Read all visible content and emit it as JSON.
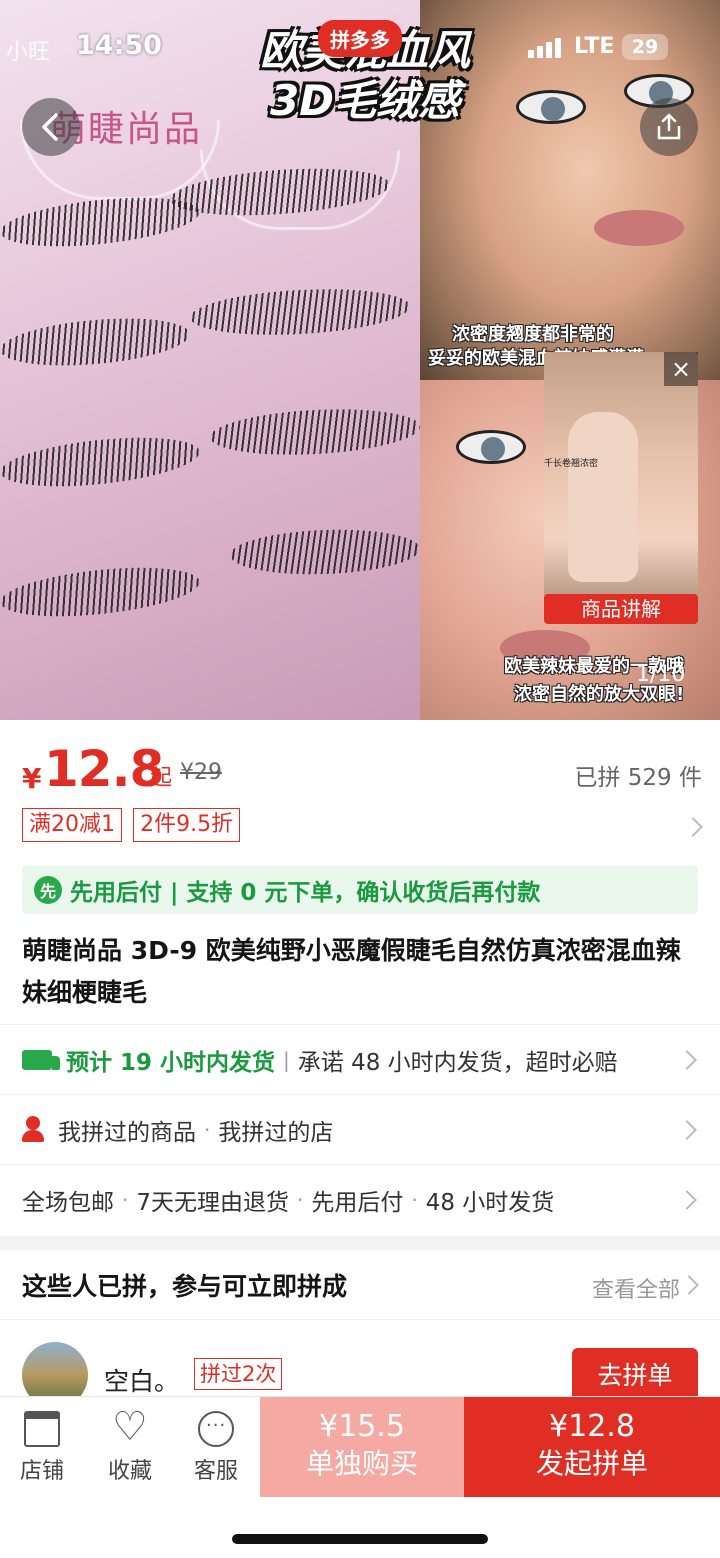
{
  "status_bar": {
    "app": "小旺",
    "time": "14:50",
    "network": "LTE",
    "battery": "29"
  },
  "hero": {
    "brand": "萌睫尚品",
    "caption_line1": "欧美混血风",
    "caption_line2": "3D毛绒感",
    "badge": "拼多多",
    "overlay1": "浓密度翘度都非常的",
    "overlay2": "妥妥的欧美混血辣妹感满满",
    "overlay3": "欧美辣妹最爱的一款哦",
    "overlay4": "浓密自然的放大双眼!",
    "video_small_text": "千长卷翘浓密",
    "video_label": "商品讲解",
    "counter": "1/10"
  },
  "price": {
    "currency": "¥",
    "value": "12.8",
    "suffix": "起",
    "original": "¥29",
    "sold": "已拼 529 件"
  },
  "promos": [
    "满20减1",
    "2件9.5折"
  ],
  "pay_later": {
    "icon": "先",
    "text": "先用后付 | 支持 0 元下单，确认收货后再付款"
  },
  "product_title": "萌睫尚品 3D-9 欧美纯野小恶魔假睫毛自然仿真浓密混血辣妹细梗睫毛",
  "shipping": {
    "eta": "预计 19 小时内发货",
    "promise": "承诺 48 小时内发货，超时必赔"
  },
  "history": {
    "item1": "我拼过的商品",
    "item2": "我拼过的店"
  },
  "services": [
    "全场包邮",
    "7天无理由退货",
    "先用后付",
    "48 小时发货"
  ],
  "join_section": {
    "title": "这些人已拼，参与可立即拼成",
    "more": "查看全部"
  },
  "joiner": {
    "name": "空白。",
    "tag": "拼过2次",
    "button": "去拼单"
  },
  "bottom_bar": {
    "store": "店铺",
    "favorite": "收藏",
    "service": "客服",
    "alone_price": "¥15.5",
    "alone_label": "单独购买",
    "group_price": "¥12.8",
    "group_label": "发起拼单"
  },
  "colors": {
    "accent": "#e02e24",
    "green": "#1a9a3e",
    "light_red": "#f4a9a3"
  }
}
